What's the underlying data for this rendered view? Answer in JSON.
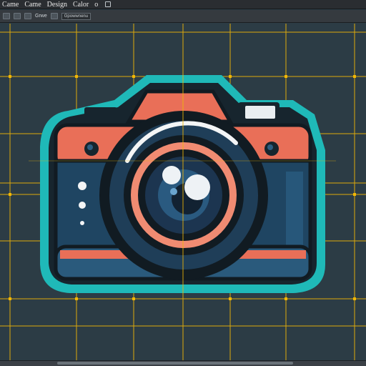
{
  "menu": {
    "items": [
      "Came",
      "Came",
      "Design",
      "Calor"
    ],
    "suffix": "o"
  },
  "toolbar": {
    "label_1": "Grwe",
    "field_value": "Gpowwnenu"
  },
  "colors": {
    "background": "#2c3c45",
    "grid": "#f2b705",
    "outline_accent": "#1fb9b8",
    "camera_body": "#e96f58",
    "camera_panel": "#1f4562",
    "lens_ring": "#f08b72"
  },
  "icons": [
    "window-icon",
    "toolbar-tool-icon",
    "camera-illustration"
  ]
}
